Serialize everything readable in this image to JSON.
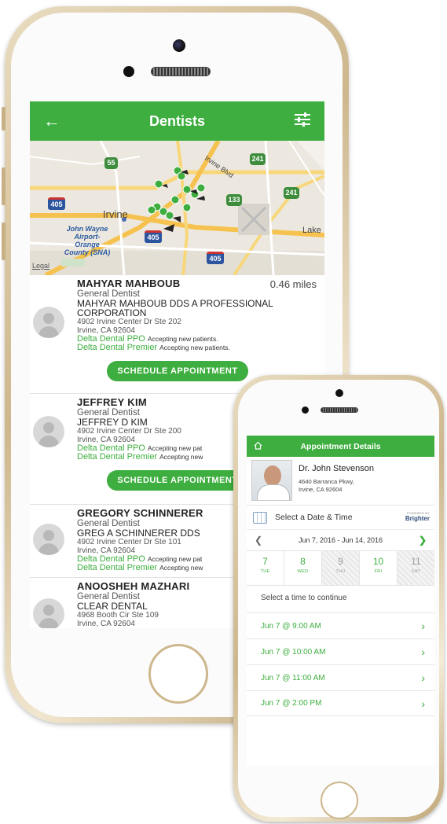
{
  "dentists_screen": {
    "header": {
      "title": "Dentists",
      "back_icon": "arrow-left-icon",
      "filter_icon": "filter-sliders-icon"
    },
    "map": {
      "labels": {
        "irvine": "Irvine",
        "irvine_blvd": "Irvine Blvd",
        "lake": "Lake",
        "airport": "John Wayne Airport-Orange County (SNA)",
        "legal": "Legal"
      },
      "shields": {
        "s55": "55",
        "s241a": "241",
        "s241b": "241",
        "s133": "133",
        "s405a": "405",
        "s405b": "405",
        "s405c": "405"
      }
    },
    "dentists": [
      {
        "name": "MAHYAR MAHBOUB",
        "distance": "0.46 miles",
        "specialty": "General Dentist",
        "practice": "MAHYAR MAHBOUB DDS A PROFESSIONAL CORPORATION",
        "address1": "4902 Irvine Center Dr Ste 202",
        "address2": "Irvine, CA 92604",
        "plans": [
          {
            "name": "Delta Dental PPO",
            "status": "Accepting new patients."
          },
          {
            "name": "Delta Dental Premier",
            "status": "Accepting new patients."
          }
        ],
        "button": "SCHEDULE APPOINTMENT"
      },
      {
        "name": "JEFFREY KIM",
        "specialty": "General Dentist",
        "practice": "JEFFREY D KIM",
        "address1": "4902 Irvine Center Dr Ste 200",
        "address2": "Irvine, CA 92604",
        "plans": [
          {
            "name": "Delta Dental PPO",
            "status": "Accepting new pat"
          },
          {
            "name": "Delta Dental Premier",
            "status": "Accepting new"
          }
        ],
        "button": "SCHEDULE APPOINTMENT"
      },
      {
        "name": "GREGORY SCHINNERER",
        "specialty": "General Dentist",
        "practice": "GREG A SCHINNERER DDS",
        "address1": "4902 Irvine Center Dr Ste 101",
        "address2": "Irvine, CA 92604",
        "plans": [
          {
            "name": "Delta Dental PPO",
            "status": "Accepting new pat"
          },
          {
            "name": "Delta Dental Premier",
            "status": "Accepting new"
          }
        ]
      },
      {
        "name": "ANOOSHEH MAZHARI",
        "specialty": "General Dentist",
        "practice": "CLEAR DENTAL",
        "address1": "4968 Booth Cir Ste 109",
        "address2": "Irvine, CA 92604"
      }
    ]
  },
  "appointment_screen": {
    "header": {
      "title": "Appointment Details",
      "home_icon": "home-icon"
    },
    "doctor": {
      "name": "Dr. John Stevenson",
      "address1": "4640 Barranca Pkwy,",
      "address2": "Irvine, CA 92604"
    },
    "select_label": "Select a Date & Time",
    "powered_by": "POWERED BY",
    "brand": "Brighter",
    "date_range": "Jun 7, 2016 - Jun 14, 2016",
    "days": [
      {
        "num": "7",
        "dow": "TUE",
        "available": true
      },
      {
        "num": "8",
        "dow": "WED",
        "available": true
      },
      {
        "num": "9",
        "dow": "THU",
        "available": false
      },
      {
        "num": "10",
        "dow": "FRI",
        "available": true
      },
      {
        "num": "11",
        "dow": "SAT",
        "available": false
      }
    ],
    "prompt": "Select a time to continue",
    "slots": [
      "Jun 7 @ 9:00 AM",
      "Jun 7 @ 10:00 AM",
      "Jun 7 @ 11:00 AM",
      "Jun 7 @ 2:00 PM"
    ]
  },
  "colors": {
    "accent_green": "#3dae3f",
    "gold_frame": "#cdb78d"
  }
}
